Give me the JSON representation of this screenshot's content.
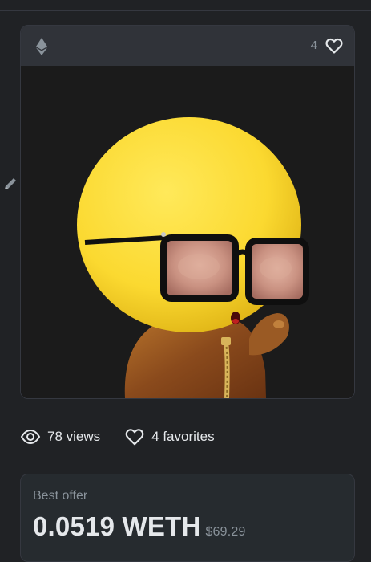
{
  "card": {
    "favorites_count": "4",
    "chain_icon": "ethereum-icon",
    "like_icon": "heart-outline-icon"
  },
  "stats": {
    "views_label": "78 views",
    "views_icon": "eye-icon",
    "favorites_label": "4 favorites",
    "favorites_icon": "heart-outline-icon"
  },
  "offer": {
    "label": "Best offer",
    "price": "0.0519 WETH",
    "usd": "$69.29"
  },
  "colors": {
    "background": "#202225",
    "card_header": "#303339",
    "muted_text": "#8a939b",
    "primary_text": "#e5e8eb"
  }
}
